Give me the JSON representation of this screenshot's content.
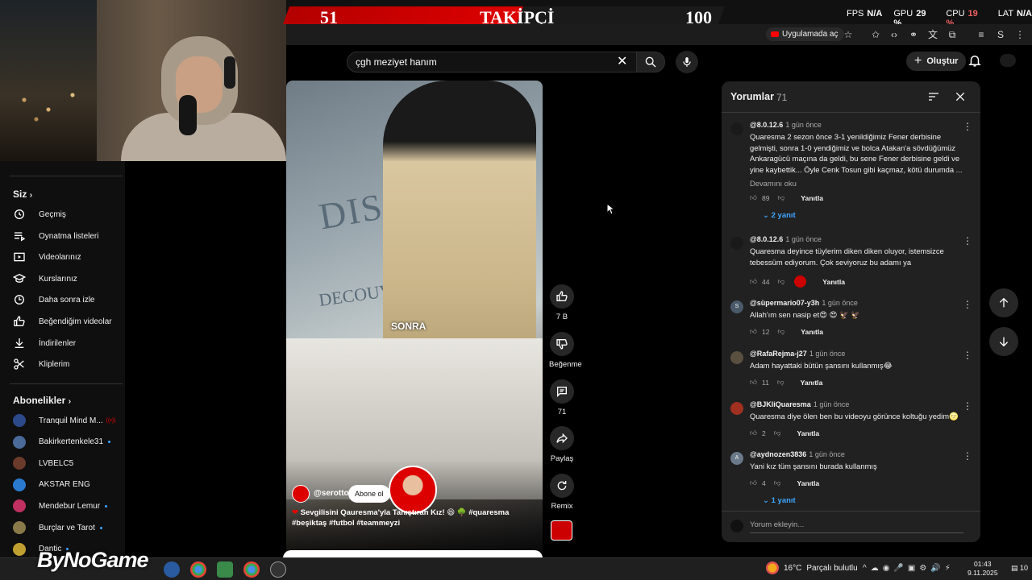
{
  "overlay": {
    "follower_current": "51",
    "follower_label": "TAKİPÇİ",
    "follower_goal": "100",
    "stats": [
      {
        "label": "FPS",
        "value": "N/A"
      },
      {
        "label": "GPU",
        "value": "29 %"
      },
      {
        "label": "CPU",
        "value": "19 %"
      },
      {
        "label": "LAT",
        "value": "N/A"
      }
    ],
    "brand": "ByNoGame"
  },
  "browser": {
    "open_in_app": "Uygulamada aç"
  },
  "header": {
    "search_value": "çgh meziyet hanım",
    "create_label": "Oluştur"
  },
  "sidebar": {
    "you_heading": "Siz",
    "you_items": [
      {
        "label": "Geçmiş",
        "icon": "history-icon"
      },
      {
        "label": "Oynatma listeleri",
        "icon": "playlists-icon"
      },
      {
        "label": "Videolarınız",
        "icon": "your-videos-icon"
      },
      {
        "label": "Kurslarınız",
        "icon": "courses-icon"
      },
      {
        "label": "Daha sonra izle",
        "icon": "watch-later-icon"
      },
      {
        "label": "Beğendiğim videolar",
        "icon": "liked-icon"
      },
      {
        "label": "İndirilenler",
        "icon": "download-icon"
      },
      {
        "label": "Kliplerim",
        "icon": "scissors-icon"
      }
    ],
    "subs_heading": "Abonelikler",
    "subscriptions": [
      {
        "name": "Tranquil Mind M...",
        "indicator": "live",
        "color": "#2c4a8a"
      },
      {
        "name": "Bakirkertenkele31",
        "indicator": "dot",
        "color": "#4a6a9a"
      },
      {
        "name": "LVBELC5",
        "indicator": "none",
        "color": "#6a3a2a"
      },
      {
        "name": "AKSTAR ENG",
        "indicator": "none",
        "color": "#2a7ad0"
      },
      {
        "name": "Mendebur Lemur",
        "indicator": "dot",
        "color": "#c03060"
      },
      {
        "name": "Burçlar ve Tarot",
        "indicator": "dot",
        "color": "#8a7a4a"
      },
      {
        "name": "Dantic",
        "indicator": "dot",
        "color": "#c0a030"
      }
    ]
  },
  "video": {
    "banner_text": "DISCO",
    "banner_bottom": "DECOUVERTE",
    "overlay_text": "SONRA",
    "channel": "@serotto",
    "subscribe_label": "Abone ol",
    "caption_heart": "❤",
    "caption": "Sevgilisini Qauresma'yla Tanıştıran Kız! 😆 🌳 #quaresma #beşiktaş #futbol #teammeyzi"
  },
  "actions": {
    "like_count": "7 B",
    "dislike_label": "Beğenme",
    "comment_count": "71",
    "share_label": "Paylaş",
    "remix_label": "Remix"
  },
  "comments": {
    "title": "Yorumlar",
    "count": "71",
    "reply_label": "Yanıtla",
    "input_placeholder": "Yorum ekleyin...",
    "items": [
      {
        "author": "@8.0.12.6",
        "time": "1 gün önce",
        "text": "Quaresma 2 sezon önce 3-1 yenildiğimiz Fener derbisine gelmişti, sonra 1-0 yendiğimiz ve bolca Atakan'a sövdüğümüz Ankaragücü maçına da geldi, bu sene Fener derbisine geldi ve yine kaybettik... Öyle Cenk Tosun gibi kaçmaz, kötü durumda ...",
        "read_more": "Devamını oku",
        "likes": "89",
        "replies": "2 yanıt",
        "avatar_color": "#1a1a1a"
      },
      {
        "author": "@8.0.12.6",
        "time": "1 gün önce",
        "text": "Quaresma deyince tüylerim diken diken oluyor, istemsizce tebessüm ediyorum. Çok seviyoruz bu adamı ya",
        "likes": "44",
        "avatar_color": "#1a1a1a"
      },
      {
        "author": "@süpermario07-y3h",
        "time": "1 gün önce",
        "text": "Allah'ım sen nasip et😍 😍 🦅 🦅",
        "likes": "12",
        "avatar_letter": "S",
        "avatar_color": "#4a5a6a"
      },
      {
        "author": "@RafaRejma-j27",
        "time": "1 gün önce",
        "text": "Adam hayattaki bütün şansını kullanmış😂",
        "likes": "11",
        "avatar_color": "#5a5040"
      },
      {
        "author": "@BJKliQuaresma",
        "time": "1 gün önce",
        "text": "Quaresma diye ölen ben bu videoyu görünce koltuğu yedim🌝",
        "likes": "2",
        "avatar_color": "#a03020"
      },
      {
        "author": "@aydnozen3836",
        "time": "1 gün önce",
        "text": "Yani kız tüm şansını burada kullanmış",
        "likes": "4",
        "replies": "1 yanıt",
        "avatar_letter": "A",
        "avatar_color": "#6a7a8a"
      }
    ]
  },
  "taskbar": {
    "weather_temp": "16°C",
    "weather_text": "Parçalı bulutlu",
    "time": "01:43",
    "date": "9.11.2025",
    "notifications": "10"
  }
}
